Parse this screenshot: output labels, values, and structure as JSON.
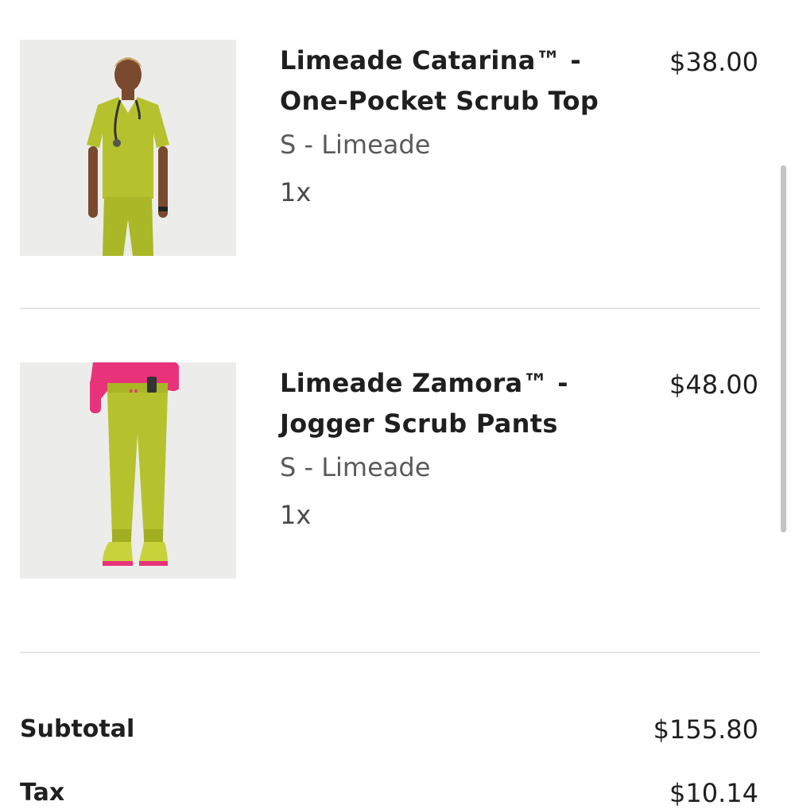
{
  "cart": {
    "items": [
      {
        "title_line1": "Limeade Catarina™ -",
        "title_line2": "One-Pocket Scrub Top",
        "variant": "S - Limeade",
        "quantity": "1x",
        "price": "$38.00"
      },
      {
        "title_line1": "Limeade Zamora™ -",
        "title_line2": "Jogger Scrub Pants",
        "variant": "S - Limeade",
        "quantity": "1x",
        "price": "$48.00"
      }
    ]
  },
  "summary": {
    "subtotal_label": "Subtotal",
    "subtotal_value": "$155.80",
    "tax_label": "Tax",
    "tax_value": "$10.14"
  },
  "colors": {
    "limeade": "#b5c22e",
    "accent_pink": "#e8327a"
  }
}
